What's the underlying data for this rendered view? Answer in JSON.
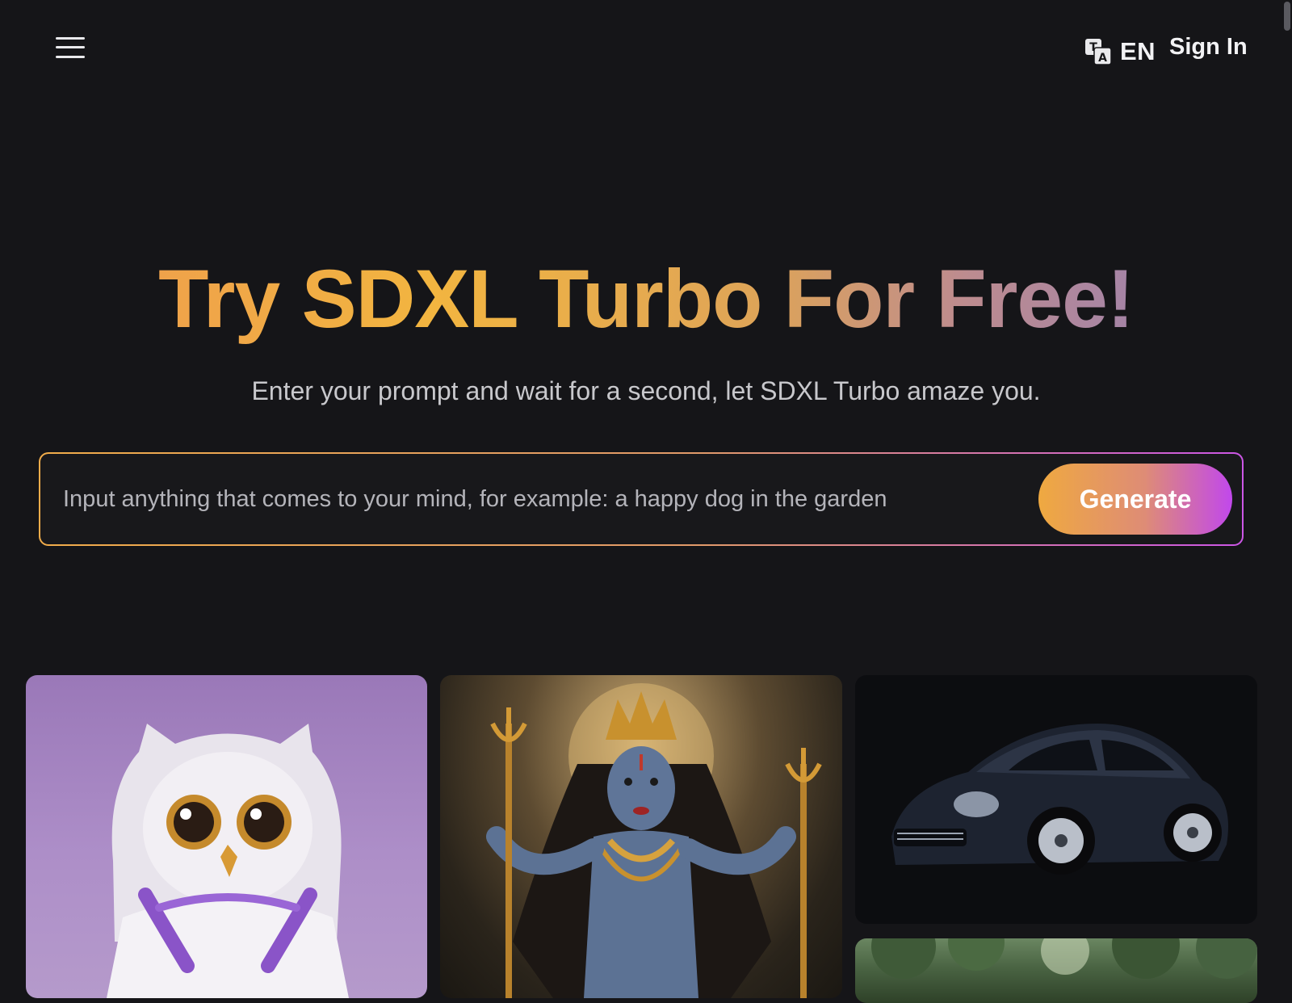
{
  "header": {
    "menu_icon": "hamburger-menu-icon",
    "translate_icon": "translate-icon",
    "language": "EN",
    "sign_in_label": "Sign In"
  },
  "hero": {
    "title": "Try SDXL Turbo For Free!",
    "subtitle": "Enter your prompt and wait for a second, let SDXL Turbo amaze you."
  },
  "prompt": {
    "value": "",
    "placeholder": "Input anything that comes to your mind, for example: a happy dog in the garden",
    "generate_label": "Generate"
  },
  "gallery": {
    "items": [
      {
        "subject": "owl in a hoodie"
      },
      {
        "subject": "multi-armed goddess"
      },
      {
        "subject": "black car"
      },
      {
        "subject": "forest"
      }
    ]
  },
  "colors": {
    "background": "#151518",
    "accent_orange": "#efa940",
    "accent_purple": "#c148ec",
    "text_muted": "#c8c8cc"
  }
}
